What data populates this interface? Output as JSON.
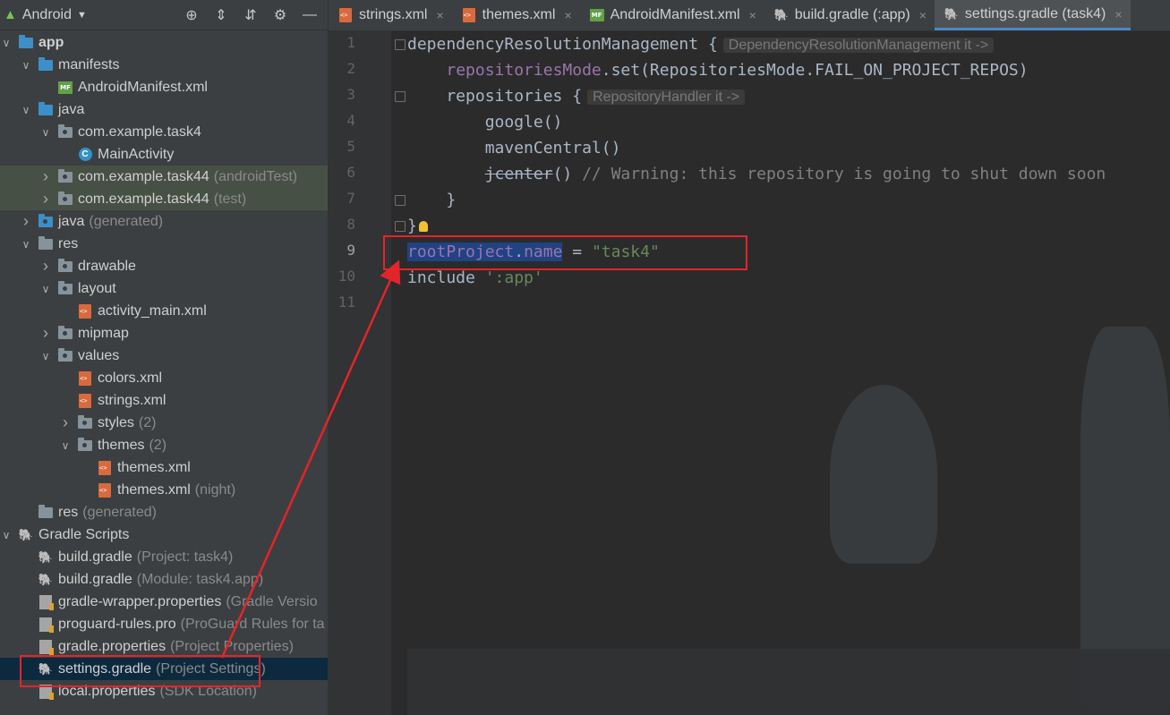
{
  "sidebar": {
    "view_selector": "Android",
    "tree": [
      {
        "label": "app",
        "indent": 0,
        "arrow": "down",
        "icon": "folder-blue",
        "bold": true
      },
      {
        "label": "manifests",
        "indent": 1,
        "arrow": "down",
        "icon": "folder-blue"
      },
      {
        "label": "AndroidManifest.xml",
        "indent": 2,
        "arrow": "none",
        "icon": "manifest"
      },
      {
        "label": "java",
        "indent": 1,
        "arrow": "down",
        "icon": "folder-blue"
      },
      {
        "label": "com.example.task4",
        "indent": 2,
        "arrow": "down",
        "icon": "package"
      },
      {
        "label": "MainActivity",
        "indent": 3,
        "arrow": "none",
        "icon": "class"
      },
      {
        "label": "com.example.task44",
        "hint": "(androidTest)",
        "indent": 2,
        "arrow": "right",
        "icon": "package",
        "scope": true
      },
      {
        "label": "com.example.task44",
        "hint": "(test)",
        "indent": 2,
        "arrow": "right",
        "icon": "package",
        "scope": true
      },
      {
        "label": "java",
        "hint": "(generated)",
        "indent": 1,
        "arrow": "right",
        "icon": "folder-gen"
      },
      {
        "label": "res",
        "indent": 1,
        "arrow": "down",
        "icon": "folder-res"
      },
      {
        "label": "drawable",
        "indent": 2,
        "arrow": "right",
        "icon": "package"
      },
      {
        "label": "layout",
        "indent": 2,
        "arrow": "down",
        "icon": "package"
      },
      {
        "label": "activity_main.xml",
        "indent": 3,
        "arrow": "none",
        "icon": "xml"
      },
      {
        "label": "mipmap",
        "indent": 2,
        "arrow": "right",
        "icon": "package"
      },
      {
        "label": "values",
        "indent": 2,
        "arrow": "down",
        "icon": "package"
      },
      {
        "label": "colors.xml",
        "indent": 3,
        "arrow": "none",
        "icon": "xml"
      },
      {
        "label": "strings.xml",
        "indent": 3,
        "arrow": "none",
        "icon": "xml"
      },
      {
        "label": "styles",
        "hint": "(2)",
        "indent": 3,
        "arrow": "right",
        "icon": "package"
      },
      {
        "label": "themes",
        "hint": "(2)",
        "indent": 3,
        "arrow": "down",
        "icon": "package"
      },
      {
        "label": "themes.xml",
        "indent": 4,
        "arrow": "none",
        "icon": "xml"
      },
      {
        "label": "themes.xml",
        "hint": "(night)",
        "indent": 4,
        "arrow": "none",
        "icon": "xml"
      },
      {
        "label": "res",
        "hint": "(generated)",
        "indent": 1,
        "arrow": "none",
        "icon": "folder-res"
      },
      {
        "label": "Gradle Scripts",
        "indent": 0,
        "arrow": "down",
        "icon": "gradle"
      },
      {
        "label": "build.gradle",
        "hint": "(Project: task4)",
        "indent": 1,
        "arrow": "none",
        "icon": "gradle"
      },
      {
        "label": "build.gradle",
        "hint": "(Module: task4.app)",
        "indent": 1,
        "arrow": "none",
        "icon": "gradle"
      },
      {
        "label": "gradle-wrapper.properties",
        "hint": "(Gradle Versio",
        "indent": 1,
        "arrow": "none",
        "icon": "props"
      },
      {
        "label": "proguard-rules.pro",
        "hint": "(ProGuard Rules for ta",
        "indent": 1,
        "arrow": "none",
        "icon": "props"
      },
      {
        "label": "gradle.properties",
        "hint": "(Project Properties)",
        "indent": 1,
        "arrow": "none",
        "icon": "props"
      },
      {
        "label": "settings.gradle",
        "hint": "(Project Settings)",
        "indent": 1,
        "arrow": "none",
        "icon": "gradle",
        "selected": true
      },
      {
        "label": "local.properties",
        "hint": "(SDK Location)",
        "indent": 1,
        "arrow": "none",
        "icon": "props"
      }
    ]
  },
  "tabs": [
    {
      "label": "strings.xml",
      "icon": "xml",
      "active": false
    },
    {
      "label": "themes.xml",
      "icon": "xml",
      "active": false
    },
    {
      "label": "AndroidManifest.xml",
      "icon": "manifest",
      "active": false
    },
    {
      "label": "build.gradle (:app)",
      "icon": "gradle",
      "active": false
    },
    {
      "label": "settings.gradle (task4)",
      "icon": "gradle",
      "active": true
    }
  ],
  "editor": {
    "current_line": 9,
    "lines": [
      [
        {
          "t": "dependencyResolutionManagement {",
          "c": ""
        },
        {
          "t": "DependencyResolutionManagement it ->",
          "c": "inlay"
        }
      ],
      [
        {
          "t": "    ",
          "c": ""
        },
        {
          "t": "repositoriesMode",
          "c": "prop"
        },
        {
          "t": ".set(RepositoriesMode.FAIL_ON_PROJECT_REPOS)",
          "c": ""
        }
      ],
      [
        {
          "t": "    repositories {",
          "c": ""
        },
        {
          "t": "RepositoryHandler it ->",
          "c": "inlay"
        }
      ],
      [
        {
          "t": "        google()",
          "c": ""
        }
      ],
      [
        {
          "t": "        mavenCentral()",
          "c": ""
        }
      ],
      [
        {
          "t": "        ",
          "c": ""
        },
        {
          "t": "jcenter",
          "c": "strike"
        },
        {
          "t": "() ",
          "c": ""
        },
        {
          "t": "// Warning: this repository is going to shut down soon",
          "c": "cmt"
        }
      ],
      [
        {
          "t": "    }",
          "c": ""
        }
      ],
      [
        {
          "t": "}",
          "c": ""
        },
        {
          "t": "",
          "c": "bulb"
        }
      ],
      [
        {
          "t": "rootProject",
          "c": "prop sel"
        },
        {
          "t": ".",
          "c": "sel"
        },
        {
          "t": "name",
          "c": "prop sel"
        },
        {
          "t": " = ",
          "c": ""
        },
        {
          "t": "\"task4\"",
          "c": "str"
        }
      ],
      [
        {
          "t": "include ",
          "c": ""
        },
        {
          "t": "':app'",
          "c": "str"
        }
      ],
      []
    ]
  },
  "colors": {
    "annotation": "#e3242b",
    "selection": "#214283",
    "accent": "#4a88c7"
  }
}
